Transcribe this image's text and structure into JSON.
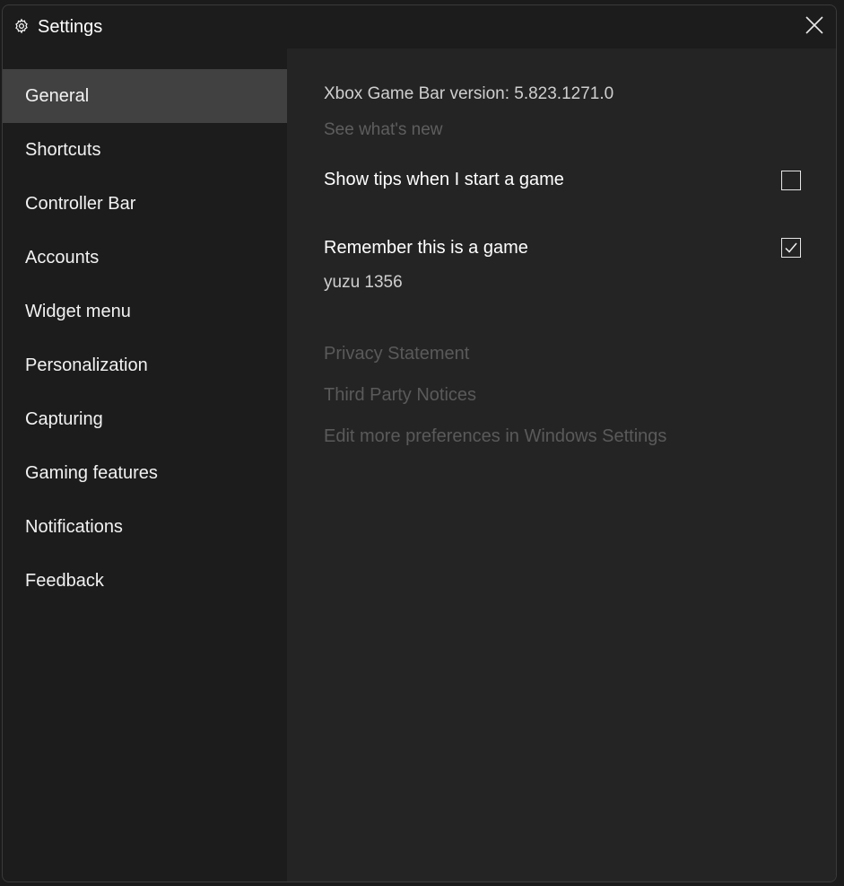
{
  "window": {
    "title": "Settings",
    "title_icon": "gear-icon",
    "close_icon": "close-icon"
  },
  "sidebar": {
    "items": [
      {
        "label": "General",
        "active": true
      },
      {
        "label": "Shortcuts",
        "active": false
      },
      {
        "label": "Controller Bar",
        "active": false
      },
      {
        "label": "Accounts",
        "active": false
      },
      {
        "label": "Widget menu",
        "active": false
      },
      {
        "label": "Personalization",
        "active": false
      },
      {
        "label": "Capturing",
        "active": false
      },
      {
        "label": "Gaming features",
        "active": false
      },
      {
        "label": "Notifications",
        "active": false
      },
      {
        "label": "Feedback",
        "active": false
      }
    ]
  },
  "general": {
    "version": "Xbox Game Bar version: 5.823.1271.0",
    "whats_new": "See what's new",
    "show_tips": {
      "label": "Show tips when I start a game",
      "checked": false
    },
    "remember_game": {
      "label": "Remember this is a game",
      "checked": true
    },
    "game_name": "yuzu 1356",
    "links": {
      "privacy": "Privacy Statement",
      "third_party": "Third Party Notices",
      "windows_settings": "Edit more preferences in Windows Settings"
    }
  },
  "colors": {
    "background": "#1c1c1c",
    "content_background": "#242424",
    "active_item": "#414141",
    "muted_link": "#5a5a5a"
  }
}
